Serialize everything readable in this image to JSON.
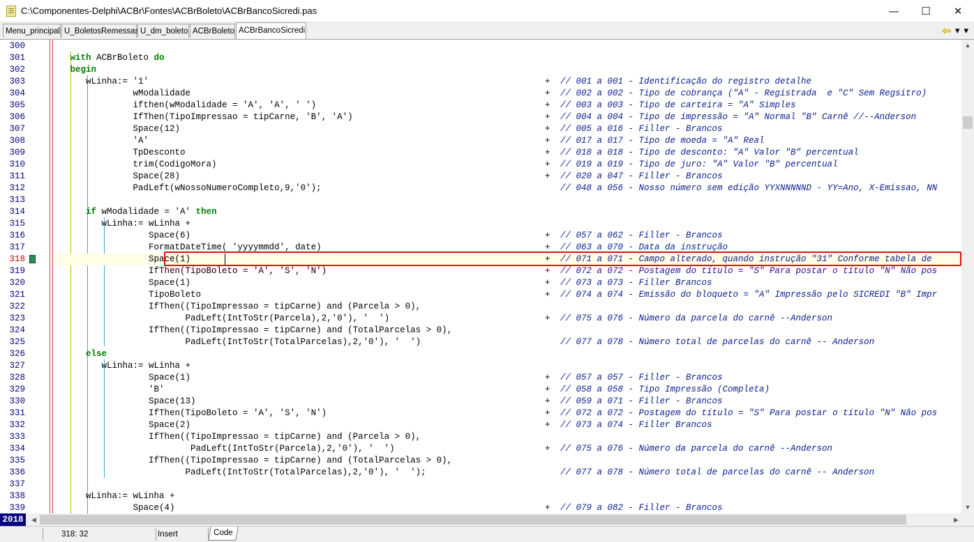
{
  "window": {
    "title": "C:\\Componentes-Delphi\\ACBr\\Fontes\\ACBrBoleto\\ACBrBancoSicredi.pas",
    "minimize": "—",
    "maximize": "☐",
    "close": "✕"
  },
  "tabs": [
    {
      "label": "Menu_principal"
    },
    {
      "label": "U_BoletosRemessas"
    },
    {
      "label": "U_dm_boleto"
    },
    {
      "label": "ACBrBoleto"
    },
    {
      "label": "ACBrBancoSicredi"
    }
  ],
  "nav": {
    "back": "⇦",
    "forward": "▾",
    "dropdown": "▾"
  },
  "lines": [
    {
      "n": "300",
      "indent": "",
      "kw1": "",
      "code": "",
      "kw2": "",
      "plus": "",
      "comment": ""
    },
    {
      "n": "301",
      "indent": "   ",
      "kw1": "with",
      "code": " ACBrBoleto ",
      "kw2": "do",
      "plus": "",
      "comment": ""
    },
    {
      "n": "302",
      "indent": "   ",
      "kw1": "begin",
      "code": "",
      "kw2": "",
      "plus": "",
      "comment": ""
    },
    {
      "n": "303",
      "indent": "      ",
      "kw1": "",
      "code": "wLinha:= '1'",
      "kw2": "",
      "plus": "+",
      "comment": "// 001 a 001 - Identificação do registro detalhe"
    },
    {
      "n": "304",
      "indent": "               ",
      "kw1": "",
      "code": "wModalidade",
      "kw2": "",
      "plus": "+",
      "comment": "// 002 a 002 - Tipo de cobrança (\"A\" - Registrada  e \"C\" Sem Regsitro)"
    },
    {
      "n": "305",
      "indent": "               ",
      "kw1": "",
      "code": "ifthen(wModalidade = 'A', 'A', ' ')",
      "kw2": "",
      "plus": "+",
      "comment": "// 003 a 003 - Tipo de carteira = \"A\" Simples"
    },
    {
      "n": "306",
      "indent": "               ",
      "kw1": "",
      "code": "IfThen(TipoImpressao = tipCarne, 'B', 'A')",
      "kw2": "",
      "plus": "+",
      "comment": "// 004 a 004 - Tipo de impressão = \"A\" Normal \"B\" Carnê //--Anderson"
    },
    {
      "n": "307",
      "indent": "               ",
      "kw1": "",
      "code": "Space(12)",
      "kw2": "",
      "plus": "+",
      "comment": "// 005 a 016 - Filler - Brancos"
    },
    {
      "n": "308",
      "indent": "               ",
      "kw1": "",
      "code": "'A'",
      "kw2": "",
      "plus": "+",
      "comment": "// 017 a 017 - Tipo de moeda = \"A\" Real"
    },
    {
      "n": "309",
      "indent": "               ",
      "kw1": "",
      "code": "TpDesconto",
      "kw2": "",
      "plus": "+",
      "comment": "// 018 a 018 - Tipo de desconto: \"A\" Valor \"B\" percentual"
    },
    {
      "n": "310",
      "indent": "               ",
      "kw1": "",
      "code": "trim(CodigoMora)",
      "kw2": "",
      "plus": "+",
      "comment": "// 019 a 019 - Tipo de juro: \"A\" Valor \"B\" percentual"
    },
    {
      "n": "311",
      "indent": "               ",
      "kw1": "",
      "code": "Space(28)",
      "kw2": "",
      "plus": "+",
      "comment": "// 020 a 047 - Filler - Brancos"
    },
    {
      "n": "312",
      "indent": "               ",
      "kw1": "",
      "code": "PadLeft(wNossoNumeroCompleto,9,'0');",
      "kw2": "",
      "plus": "",
      "comment": "// 048 a 056 - Nosso número sem edição YYXNNNNND - YY=Ano, X-Emissao, NN"
    },
    {
      "n": "313",
      "indent": "",
      "kw1": "",
      "code": "",
      "kw2": "",
      "plus": "",
      "comment": ""
    },
    {
      "n": "314",
      "indent": "      ",
      "kw1": "if",
      "code": " wModalidade = 'A' ",
      "kw2": "then",
      "plus": "",
      "comment": ""
    },
    {
      "n": "315",
      "indent": "         ",
      "kw1": "",
      "code": "wLinha:= wLinha +",
      "kw2": "",
      "plus": "",
      "comment": ""
    },
    {
      "n": "316",
      "indent": "                  ",
      "kw1": "",
      "code": "Space(6)",
      "kw2": "",
      "plus": "+",
      "comment": "// 057 a 062 - Filler - Brancos"
    },
    {
      "n": "317",
      "indent": "                  ",
      "kw1": "",
      "code": "FormatDateTime( 'yyyymmdd', date)",
      "kw2": "",
      "plus": "+",
      "comment": "// 063 a 070 - Data da instrução"
    },
    {
      "n": "318",
      "indent": "                  ",
      "kw1": "",
      "code": "Space(1)",
      "kw2": "",
      "plus": "+",
      "comment": "// 071 a 071 - Campo alterado, quando instrução \"31\" Conforme tabela de"
    },
    {
      "n": "319",
      "indent": "                  ",
      "kw1": "",
      "code": "IfThen(TipoBoleto = 'A', 'S', 'N')",
      "kw2": "",
      "plus": "+",
      "comment": "// 072 a 072 - Postagem do título = \"S\" Para postar o título \"N\" Não pos"
    },
    {
      "n": "320",
      "indent": "                  ",
      "kw1": "",
      "code": "Space(1)",
      "kw2": "",
      "plus": "+",
      "comment": "// 073 a 073 - Filler Brancos"
    },
    {
      "n": "321",
      "indent": "                  ",
      "kw1": "",
      "code": "TipoBoleto",
      "kw2": "",
      "plus": "+",
      "comment": "// 074 a 074 - Emissão do bloqueto = \"A\" Impressão pelo SICREDI \"B\" Impr"
    },
    {
      "n": "322",
      "indent": "                  ",
      "kw1": "",
      "code": "IfThen((TipoImpressao = tipCarne) and (Parcela > 0),",
      "kw2": "",
      "plus": "",
      "comment": ""
    },
    {
      "n": "323",
      "indent": "                         ",
      "kw1": "",
      "code": "PadLeft(IntToStr(Parcela),2,'0'), '  ')",
      "kw2": "",
      "plus": "+",
      "comment": "// 075 a 076 - Número da parcela do carnê --Anderson"
    },
    {
      "n": "324",
      "indent": "                  ",
      "kw1": "",
      "code": "IfThen((TipoImpressao = tipCarne) and (TotalParcelas > 0),",
      "kw2": "",
      "plus": "",
      "comment": ""
    },
    {
      "n": "325",
      "indent": "                         ",
      "kw1": "",
      "code": "PadLeft(IntToStr(TotalParcelas),2,'0'), '  ')",
      "kw2": "",
      "plus": "",
      "comment": "// 077 a 078 - Número total de parcelas do carnê -- Anderson"
    },
    {
      "n": "326",
      "indent": "      ",
      "kw1": "else",
      "code": "",
      "kw2": "",
      "plus": "",
      "comment": ""
    },
    {
      "n": "327",
      "indent": "         ",
      "kw1": "",
      "code": "wLinha:= wLinha +",
      "kw2": "",
      "plus": "",
      "comment": ""
    },
    {
      "n": "328",
      "indent": "                  ",
      "kw1": "",
      "code": "Space(1)",
      "kw2": "",
      "plus": "+",
      "comment": "// 057 a 057 - Filler - Brancos"
    },
    {
      "n": "329",
      "indent": "                  ",
      "kw1": "",
      "code": "'B'",
      "kw2": "",
      "plus": "+",
      "comment": "// 058 a 058 - Tipo Impressão (Completa)"
    },
    {
      "n": "330",
      "indent": "                  ",
      "kw1": "",
      "code": "Space(13)",
      "kw2": "",
      "plus": "+",
      "comment": "// 059 a 071 - Filler - Brancos"
    },
    {
      "n": "331",
      "indent": "                  ",
      "kw1": "",
      "code": "IfThen(TipoBoleto = 'A', 'S', 'N')",
      "kw2": "",
      "plus": "+",
      "comment": "// 072 a 072 - Postagem do título = \"S\" Para postar o título \"N\" Não pos"
    },
    {
      "n": "332",
      "indent": "                  ",
      "kw1": "",
      "code": "Space(2)",
      "kw2": "",
      "plus": "+",
      "comment": "// 073 a 074 - Filler Brancos"
    },
    {
      "n": "333",
      "indent": "                  ",
      "kw1": "",
      "code": "IfThen((TipoImpressao = tipCarne) and (Parcela > 0),",
      "kw2": "",
      "plus": "",
      "comment": ""
    },
    {
      "n": "334",
      "indent": "                          ",
      "kw1": "",
      "code": "PadLeft(IntToStr(Parcela),2,'0'), '  ')",
      "kw2": "",
      "plus": "+",
      "comment": "// 075 a 076 - Número da parcela do carnê --Anderson"
    },
    {
      "n": "335",
      "indent": "                  ",
      "kw1": "",
      "code": "IfThen((TipoImpressao = tipCarne) and (TotalParcelas > 0),",
      "kw2": "",
      "plus": "",
      "comment": ""
    },
    {
      "n": "336",
      "indent": "                         ",
      "kw1": "",
      "code": "PadLeft(IntToStr(TotalParcelas),2,'0'), '  ');",
      "kw2": "",
      "plus": "",
      "comment": "// 077 a 078 - Número total de parcelas do carnê -- Anderson"
    },
    {
      "n": "337",
      "indent": "",
      "kw1": "",
      "code": "",
      "kw2": "",
      "plus": "",
      "comment": ""
    },
    {
      "n": "338",
      "indent": "      ",
      "kw1": "",
      "code": "wLinha:= wLinha +",
      "kw2": "",
      "plus": "",
      "comment": ""
    },
    {
      "n": "339",
      "indent": "               ",
      "kw1": "",
      "code": "Space(4)",
      "kw2": "",
      "plus": "+",
      "comment": "// 079 a 082 - Filler - Brancos"
    }
  ],
  "current_line": "318",
  "bookmark_line": "318",
  "line_count": "2018",
  "status": {
    "position": "318: 32",
    "mode": "Insert",
    "view_tab": "Code"
  },
  "colors": {
    "keyword": "#008000",
    "comment": "#0a1d8c",
    "line_number": "#000080",
    "highlight_border": "#e01010"
  }
}
